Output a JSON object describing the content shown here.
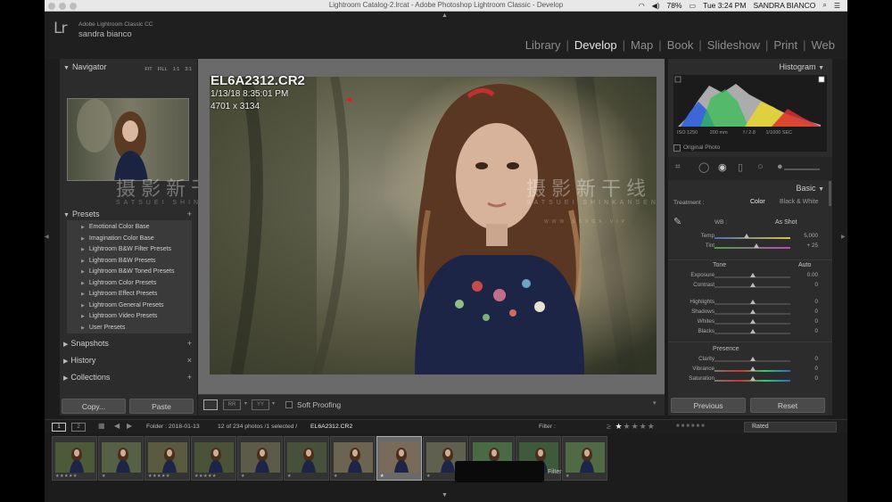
{
  "window": {
    "title": "Lightroom Catalog-2.lrcat - Adobe Photoshop Lightroom Classic - Develop",
    "battery": "78%",
    "clock": "Tue 3:24 PM",
    "user_menu": "SANDRA BIANCO"
  },
  "app": {
    "product": "Adobe Lightroom Classic CC",
    "user": "sandra bianco",
    "logo": "Lr",
    "modules": [
      "Library",
      "Develop",
      "Map",
      "Book",
      "Slideshow",
      "Print",
      "Web"
    ],
    "active_module": "Develop"
  },
  "left_panel": {
    "navigator": {
      "title": "Navigator",
      "zoom": [
        "FIT",
        "FILL",
        "1:1",
        "3:1"
      ]
    },
    "presets": {
      "title": "Presets",
      "items": [
        "Emotional Color Base",
        "Imagination Color Base",
        "Lightroom B&W Filter Presets",
        "Lightroom B&W Presets",
        "Lightroom B&W Toned Presets",
        "Lightroom Color Presets",
        "Lightroom Effect Presets",
        "Lightroom General Presets",
        "Lightroom Video Presets",
        "User Presets"
      ]
    },
    "snapshots": "Snapshots",
    "history": "History",
    "collections": "Collections",
    "copy_label": "Copy...",
    "paste_label": "Paste"
  },
  "photo": {
    "filename": "EL6A2312.CR2",
    "datetime": "1/13/18 8:35:01 PM",
    "dimensions": "4701 x 3134"
  },
  "toolbar": {
    "soft_proofing": "Soft Proofing"
  },
  "watermark": {
    "chinese": "摄影新干线",
    "latin": "SATSUEI SHINKANSEN",
    "url": "WWW.SSXGX.VIP"
  },
  "right_panel": {
    "histogram": {
      "title": "Histogram",
      "iso": "ISO 1250",
      "focal": "200 mm",
      "aperture": "f / 2.8",
      "shutter": "1/1000 SEC",
      "original_photo": "Original Photo"
    },
    "basic": {
      "title": "Basic",
      "treatment_label": "Treatment :",
      "color": "Color",
      "bw": "Black & White",
      "wb_label": "WB :",
      "wb_value": "As Shot",
      "tone_label": "Tone",
      "auto": "Auto",
      "presence_label": "Presence",
      "sliders_wb": [
        {
          "label": "Temp",
          "value": "5,000",
          "pos": 0.42
        },
        {
          "label": "Tint",
          "value": "+ 25",
          "pos": 0.55
        }
      ],
      "sliders_tone": [
        {
          "label": "Exposure",
          "value": "0.00",
          "pos": 0.5
        },
        {
          "label": "Contrast",
          "value": "0",
          "pos": 0.5
        }
      ],
      "sliders_hs": [
        {
          "label": "Highlights",
          "value": "0",
          "pos": 0.5
        },
        {
          "label": "Shadows",
          "value": "0",
          "pos": 0.5
        },
        {
          "label": "Whites",
          "value": "0",
          "pos": 0.5
        },
        {
          "label": "Blacks",
          "value": "0",
          "pos": 0.5
        }
      ],
      "sliders_presence": [
        {
          "label": "Clarity",
          "value": "0",
          "pos": 0.5
        },
        {
          "label": "Vibrance",
          "value": "0",
          "pos": 0.5
        },
        {
          "label": "Saturation",
          "value": "0",
          "pos": 0.5
        }
      ]
    },
    "previous": "Previous",
    "reset": "Reset"
  },
  "filmbar": {
    "page1": "1",
    "page2": "2",
    "folder": "Folder : 2018-01-13",
    "count": "12 of 234 photos /1 selected /",
    "selected_file": "EL6A2312.CR2",
    "filter_label": "Filter :",
    "rated": "Rated",
    "tooltip": "Filter"
  },
  "thumbnails": [
    {
      "stars": "★★★★★",
      "selected": false
    },
    {
      "stars": "★",
      "selected": false
    },
    {
      "stars": "★★★★★",
      "selected": false
    },
    {
      "stars": "★★★★★",
      "selected": false
    },
    {
      "stars": "★",
      "selected": false
    },
    {
      "stars": "★",
      "selected": false
    },
    {
      "stars": "★",
      "selected": false
    },
    {
      "stars": "★",
      "selected": true
    },
    {
      "stars": "★",
      "selected": false
    },
    {
      "stars": "★",
      "selected": false
    },
    {
      "stars": "",
      "selected": false
    },
    {
      "stars": "★",
      "selected": false
    }
  ],
  "colors": {
    "accent": "#e6e6e6",
    "panel": "#2c2c2c",
    "background": "#1c1c1c"
  }
}
